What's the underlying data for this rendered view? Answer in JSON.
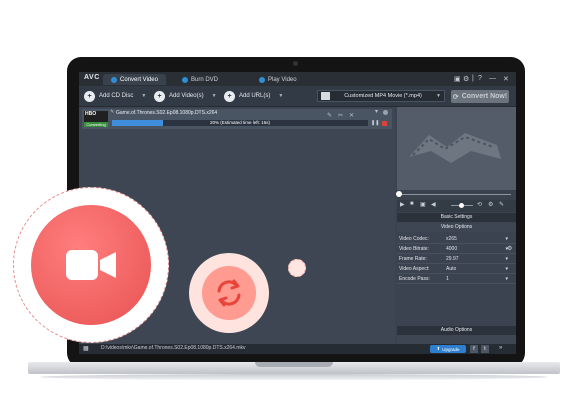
{
  "app": {
    "logo": "AVC",
    "tabs": [
      {
        "label": "Convert Video",
        "icon": "video-tab-icon",
        "active": true
      },
      {
        "label": "Burn DVD",
        "icon": "dvd-tab-icon",
        "active": false
      },
      {
        "label": "Play Video",
        "icon": "play-tab-icon",
        "active": false
      }
    ],
    "window_controls": [
      "▣",
      "⚙",
      "|",
      "?",
      "—",
      "✕"
    ]
  },
  "toolbar": {
    "add_cd_disc": "Add CD Disc",
    "add_videos": "Add Video(s)",
    "add_urls": "Add URL(s)",
    "profile": "Customized MP4 Movie (*.mp4)",
    "convert": "Convert Now!"
  },
  "file": {
    "thumb_text": "HBO",
    "badge": "Converting",
    "name": "Game.of.Thrones.S02.Ep08.1080p.DTS.x264",
    "progress_text": "20% (Estimated time left: 16s)",
    "progress": 0.2
  },
  "settings": {
    "basic_settings": "Basic Settings",
    "video_options": "Video Options",
    "audio_options": "Audio Options",
    "rows": [
      {
        "label": "Video Codec:",
        "value": "x265"
      },
      {
        "label": "Video Bitrate:",
        "value": "4000"
      },
      {
        "label": "Frame Rate:",
        "value": "29.97"
      },
      {
        "label": "Video Aspect:",
        "value": "Auto"
      },
      {
        "label": "Encode Pass:",
        "value": "1"
      }
    ]
  },
  "status": {
    "path": "D:\\videos\\mkv\\Game.of.Thrones.S02.Ep08.1080p.DTS.x264.mkv",
    "upgrade": "Upgrade"
  },
  "colors": {
    "accent": "#3f8edc",
    "camera": "#ef5a5a",
    "sync": "#ff9b91"
  }
}
